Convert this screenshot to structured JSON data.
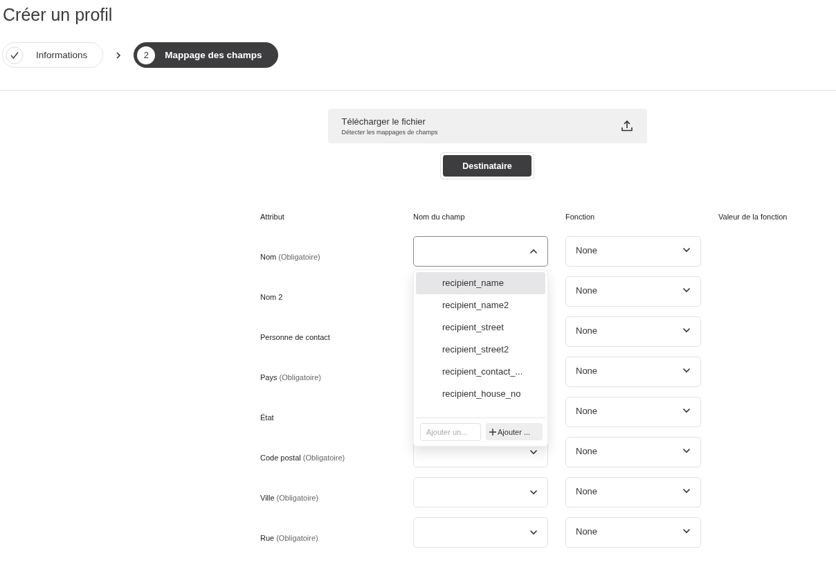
{
  "title": "Créer un profil",
  "steps": [
    {
      "label": "Informations",
      "done": true,
      "selected": false
    },
    {
      "number": "2",
      "label": "Mappage des champs",
      "done": false,
      "selected": true
    }
  ],
  "upload": {
    "title": "Télécharger le fichier",
    "subtitle": "Détecter les mappages de champs"
  },
  "segments": [
    {
      "label": "Destinataire",
      "selected": true
    }
  ],
  "table": {
    "columns": [
      "Attribut",
      "Nom du champ",
      "Fonction",
      "Valeur de la fonction"
    ],
    "rows": [
      {
        "attribute": "Nom",
        "required": "(Obligatoire)",
        "field_open": true,
        "function": "None"
      },
      {
        "attribute": "Nom 2",
        "function": "None"
      },
      {
        "attribute": "Personne de contact",
        "function": "None"
      },
      {
        "attribute": "Pays",
        "required": "(Obligatoire)",
        "function": "None"
      },
      {
        "attribute": "État",
        "function": "None"
      },
      {
        "attribute": "Code postal",
        "required": "(Obligatoire)",
        "field_open": false,
        "function": "None"
      },
      {
        "attribute": "Ville",
        "required": "(Obligatoire)",
        "field_open": false,
        "function": "None"
      },
      {
        "attribute": "Rue",
        "required": "(Obligatoire)",
        "field_open": false,
        "function": "None"
      }
    ]
  },
  "dropdown": {
    "options": [
      {
        "label": "recipient_name",
        "highlighted": true
      },
      {
        "label": "recipient_name2",
        "highlighted": false
      },
      {
        "label": "recipient_street",
        "highlighted": false
      },
      {
        "label": "recipient_street2",
        "highlighted": false
      },
      {
        "label": "recipient_contact_...",
        "highlighted": false
      },
      {
        "label": "recipient_house_no",
        "highlighted": false
      }
    ],
    "add_placeholder": "Ajouter un...",
    "add_button": "Ajouter ..."
  }
}
